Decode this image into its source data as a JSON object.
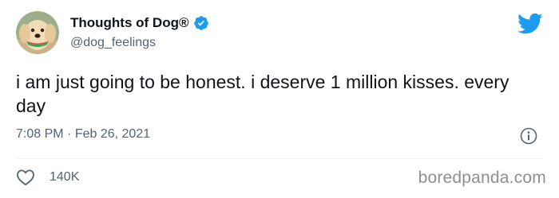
{
  "tweet": {
    "author_name": "Thoughts of Dog®",
    "author_handle": "@dog_feelings",
    "text": "i am just going to be honest. i deserve 1 million kisses. every day",
    "time": "7:08 PM",
    "separator": "·",
    "date": "Feb 26, 2021",
    "likes": "140K"
  },
  "icons": {
    "verified": "verified-badge-icon",
    "brand": "twitter-bird-icon",
    "info": "info-icon",
    "like": "heart-icon"
  },
  "watermark": "boredpanda.com",
  "colors": {
    "verified": "#1d9bf0",
    "brand": "#1d9bf0",
    "secondary_text": "#536471",
    "primary_text": "#0f1419"
  }
}
